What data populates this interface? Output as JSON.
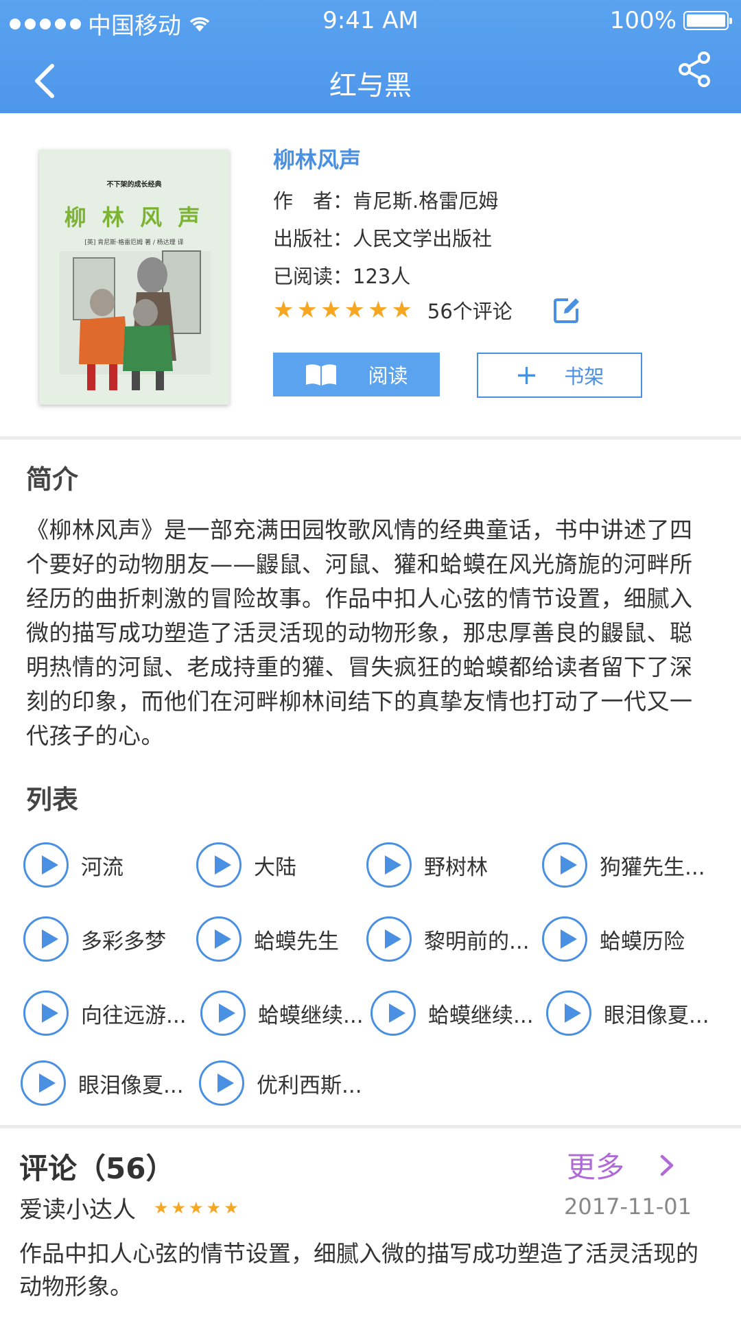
{
  "status_bar": {
    "carrier": "中国移动",
    "time": "9:41 AM",
    "battery": "100%"
  },
  "nav": {
    "title": "红与黑"
  },
  "book": {
    "title": "柳林风声",
    "author_label": "作　者：",
    "author": "肯尼斯.格雷厄姆",
    "publisher_label": "出版社：",
    "publisher": "人民文学出版社",
    "read_label": "已阅读：",
    "read_count": "123人",
    "rating_stars": 6,
    "review_count": "56个评论",
    "cover": {
      "series": "不下架的成长经典",
      "title": "柳 林 风 声",
      "author_line": "[英] 肯尼斯·格雷厄姆 著 / 杨达理 译"
    }
  },
  "buttons": {
    "read": "阅读",
    "shelf": "书架"
  },
  "intro": {
    "title": "简介",
    "text": "《柳林风声》是一部充满田园牧歌风情的经典童话，书中讲述了四个要好的动物朋友——鼹鼠、河鼠、獾和蛤蟆在风光旖旎的河畔所经历的曲折刺激的冒险故事。作品中扣人心弦的情节设置，细腻入微的描写成功塑造了活灵活现的动物形象，那忠厚善良的鼹鼠、聪明热情的河鼠、老成持重的獾、冒失疯狂的蛤蟆都给读者留下了深刻的印象，而他们在河畔柳林间结下的真挚友情也打动了一代又一代孩子的心。"
  },
  "chapters": {
    "title": "列表",
    "items": [
      {
        "name": "河流"
      },
      {
        "name": "大陆"
      },
      {
        "name": "野树林"
      },
      {
        "name": "狗獾先生..."
      },
      {
        "name": "多彩多梦"
      },
      {
        "name": "蛤蟆先生"
      },
      {
        "name": "黎明前的..."
      },
      {
        "name": "蛤蟆历险"
      },
      {
        "name": "向往远游..."
      },
      {
        "name": "蛤蟆继续..."
      },
      {
        "name": "蛤蟆继续..."
      },
      {
        "name": "眼泪像夏..."
      },
      {
        "name": "眼泪像夏..."
      },
      {
        "name": "优利西斯..."
      }
    ]
  },
  "comments": {
    "title": "评论（56）",
    "more": "更多",
    "items": [
      {
        "user": "爱读小达人",
        "stars": 5,
        "date": "2017-11-01",
        "text": "作品中扣人心弦的情节设置，细腻入微的描写成功塑造了活灵活现的动物形象。"
      }
    ]
  },
  "colors": {
    "accent": "#4a90e2",
    "header": "#5aa3f0",
    "star": "#f5a623",
    "more": "#b06ad8"
  }
}
